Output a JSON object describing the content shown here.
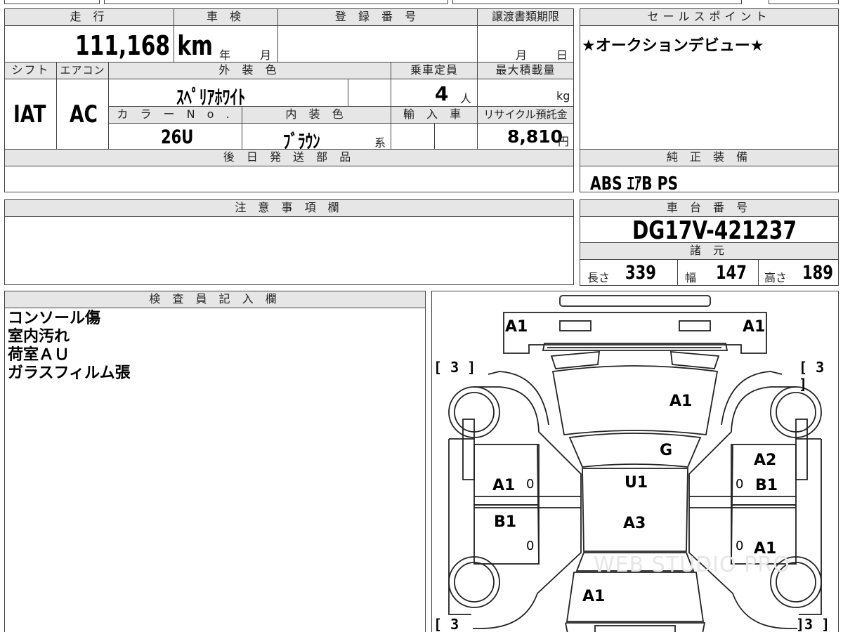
{
  "vehicle": {
    "headers": {
      "mileage": "走 行",
      "shaken": "車 検",
      "registration": "登 録 番 号",
      "transfer_deadline": "譲渡書類期限",
      "shift": "シフト",
      "aircon": "エアコン",
      "exterior_color": "外 装 色",
      "capacity": "乗車定員",
      "max_load": "最大積載量",
      "color_no": "カ ラ ー N o .",
      "interior_color": "内 装 色",
      "import": "輸 入 車",
      "recycle_fee": "リサイクル預託金",
      "later_parts": "後 日 発 送 部 品"
    },
    "mileage_value": "111,168",
    "mileage_unit": "km",
    "shaken_year_label": "年",
    "shaken_month_label": "月",
    "transfer_month_label": "月",
    "transfer_day_label": "日",
    "shift_value": "IAT",
    "aircon_value": "AC",
    "exterior_color_value": "ｽﾍﾟﾘｱﾎﾜｲﾄ",
    "capacity_value": "4",
    "capacity_unit": "人",
    "max_load_unit": "kg",
    "color_no_value": "26U",
    "interior_color_value": "ﾌﾞﾗｳﾝ",
    "interior_color_suffix": "系",
    "recycle_fee_value": "8,810",
    "recycle_fee_unit": "円"
  },
  "sales_point": {
    "header": "セールスポイント",
    "text": "★オークションデビュー★"
  },
  "standard_equipment": {
    "header": "純 正 装 備",
    "text": "ABS  ｴｱB  PS"
  },
  "notes": {
    "header": "注 意 事 項 欄"
  },
  "chassis": {
    "header": "車 台 番 号",
    "value": "DG17V-421237",
    "specs_header": "諸 元",
    "length_label": "長さ",
    "length_value": "339",
    "width_label": "幅",
    "width_value": "147",
    "height_label": "高さ",
    "height_value": "189"
  },
  "inspector": {
    "header": "検 査 員 記 入 欄",
    "lines": [
      "コンソール傷",
      "室内汚れ",
      "荷室ＡＵ",
      "ガラスフィルム張"
    ]
  },
  "diagram": {
    "watermark": "WEB STUDIO PRO",
    "marks": {
      "front_left_corner": "A1",
      "front_right_corner": "A1",
      "hood": "A1",
      "windshield": "G",
      "roof": "U1",
      "roof_rear": "A3",
      "rear_hatch": "A1",
      "left_front_door": "A1",
      "left_rear_door": "B1",
      "right_front_door_upper": "A2",
      "right_front_door": "B1",
      "right_rear_door": "A1"
    },
    "tire_front_left": "[ 3 ]",
    "tire_front_right": "[ 3 ]",
    "tire_rear_left": "[ 3",
    "tire_rear_right": "]3 ]",
    "zero_marks": [
      "0",
      "0",
      "0",
      "0"
    ]
  }
}
